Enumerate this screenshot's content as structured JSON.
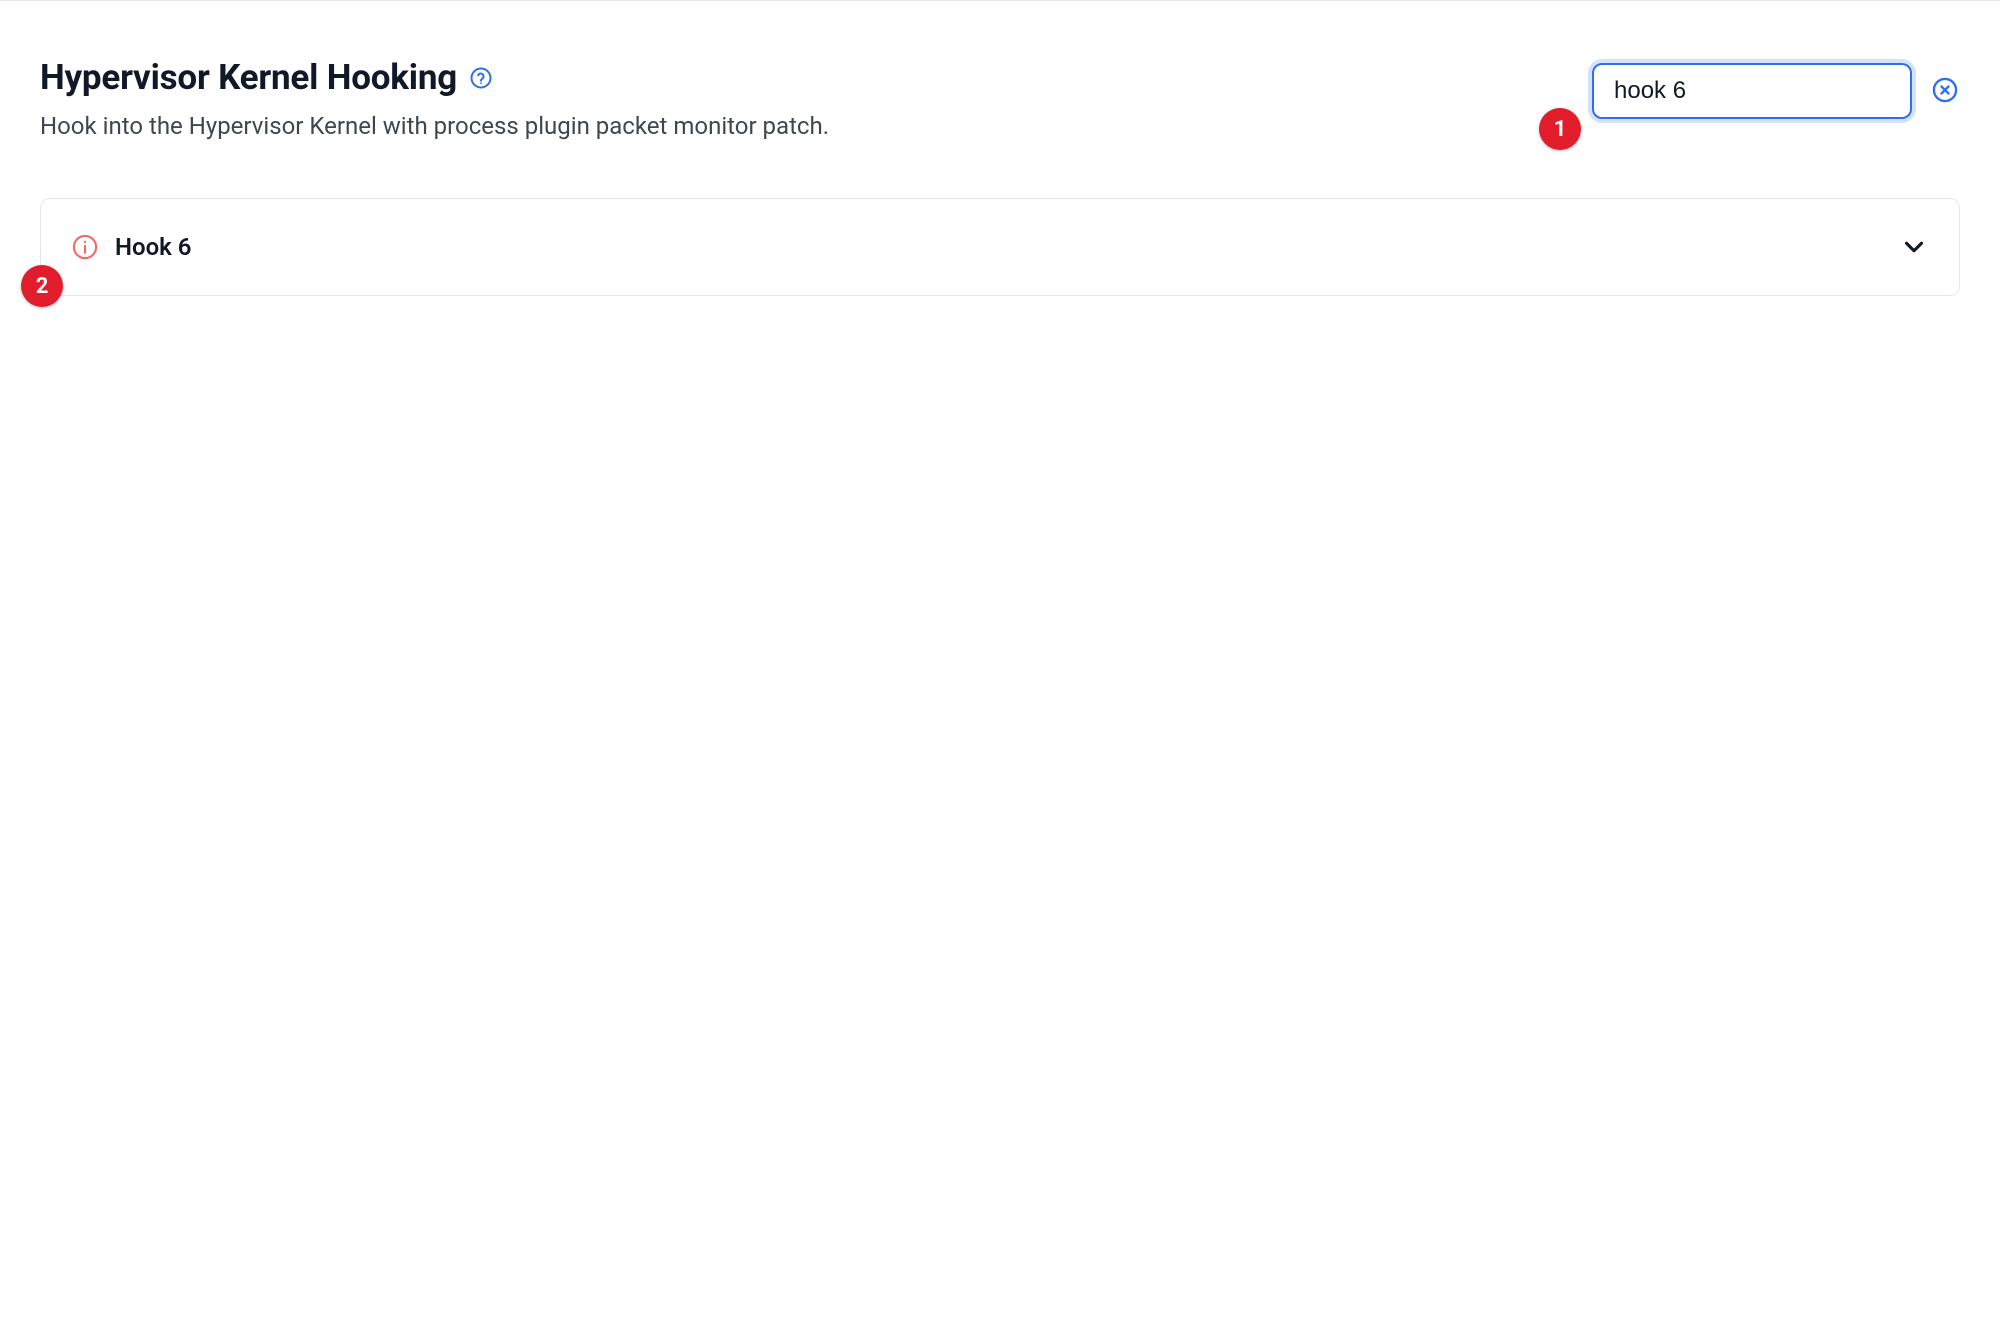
{
  "header": {
    "title": "Hypervisor Kernel Hooking",
    "subtitle": "Hook into the Hypervisor Kernel with process plugin packet monitor patch."
  },
  "search": {
    "value": "hook 6",
    "placeholder": ""
  },
  "list": {
    "items": [
      {
        "label": "Hook 6",
        "status_icon": "info-icon"
      }
    ]
  },
  "annotations": [
    {
      "id": "1"
    },
    {
      "id": "2"
    }
  ],
  "colors": {
    "accent": "#2f6fed",
    "danger": "#e11d2b",
    "info_red": "#ef6b63",
    "border": "#e5e7eb",
    "text": "#111827",
    "muted": "#404651"
  }
}
